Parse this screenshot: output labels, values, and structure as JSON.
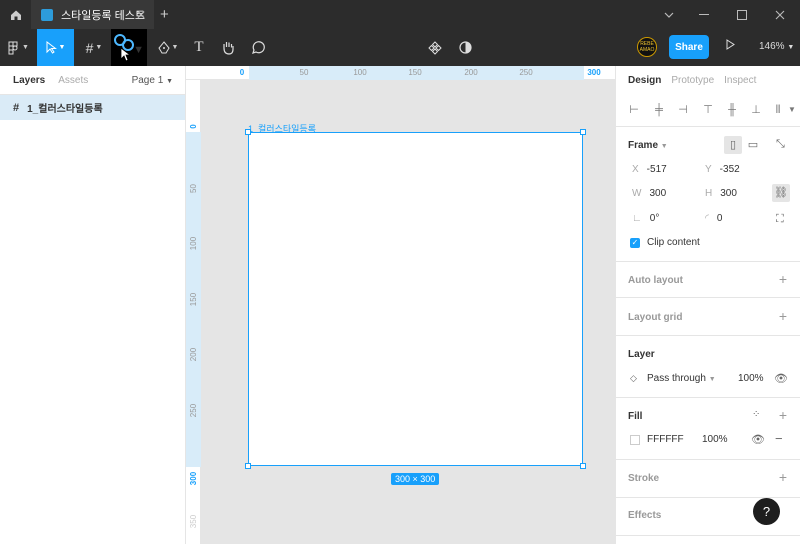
{
  "titlebar": {
    "tab_title": "스타일등록 테스트",
    "close_glyph": "✕",
    "new_tab_glyph": "+"
  },
  "toolbar": {
    "share_label": "Share",
    "zoom": "146%",
    "avatar_text": "REBE AMAO"
  },
  "layers_panel": {
    "tabs": [
      "Layers",
      "Assets"
    ],
    "page": "Page 1",
    "layer_name": "1_컬러스타일등록"
  },
  "ruler": {
    "top": [
      "0",
      "50",
      "100",
      "150",
      "200",
      "250",
      "300"
    ],
    "left": [
      "0",
      "50",
      "100",
      "150",
      "200",
      "250",
      "300",
      "350"
    ]
  },
  "canvas": {
    "frame_label": "1_컬러스타일등록",
    "size_badge": "300 × 300"
  },
  "design_panel": {
    "tabs": [
      "Design",
      "Prototype",
      "Inspect"
    ],
    "frame": {
      "title": "Frame",
      "x_label": "X",
      "x": "-517",
      "y_label": "Y",
      "y": "-352",
      "w_label": "W",
      "w": "300",
      "h_label": "H",
      "h": "300",
      "rotation": "0°",
      "radius": "0",
      "clip_content": "Clip content"
    },
    "auto_layout": "Auto layout",
    "layout_grid": "Layout grid",
    "layer": {
      "title": "Layer",
      "blend": "Pass through",
      "opacity": "100%"
    },
    "fill": {
      "title": "Fill",
      "hex": "FFFFFF",
      "opacity": "100%"
    },
    "stroke": "Stroke",
    "effects": "Effects"
  },
  "help": "?",
  "colors": {
    "accent": "#18a0fb",
    "chrome": "#2c2c2c",
    "selection_bg": "#daebf7"
  }
}
